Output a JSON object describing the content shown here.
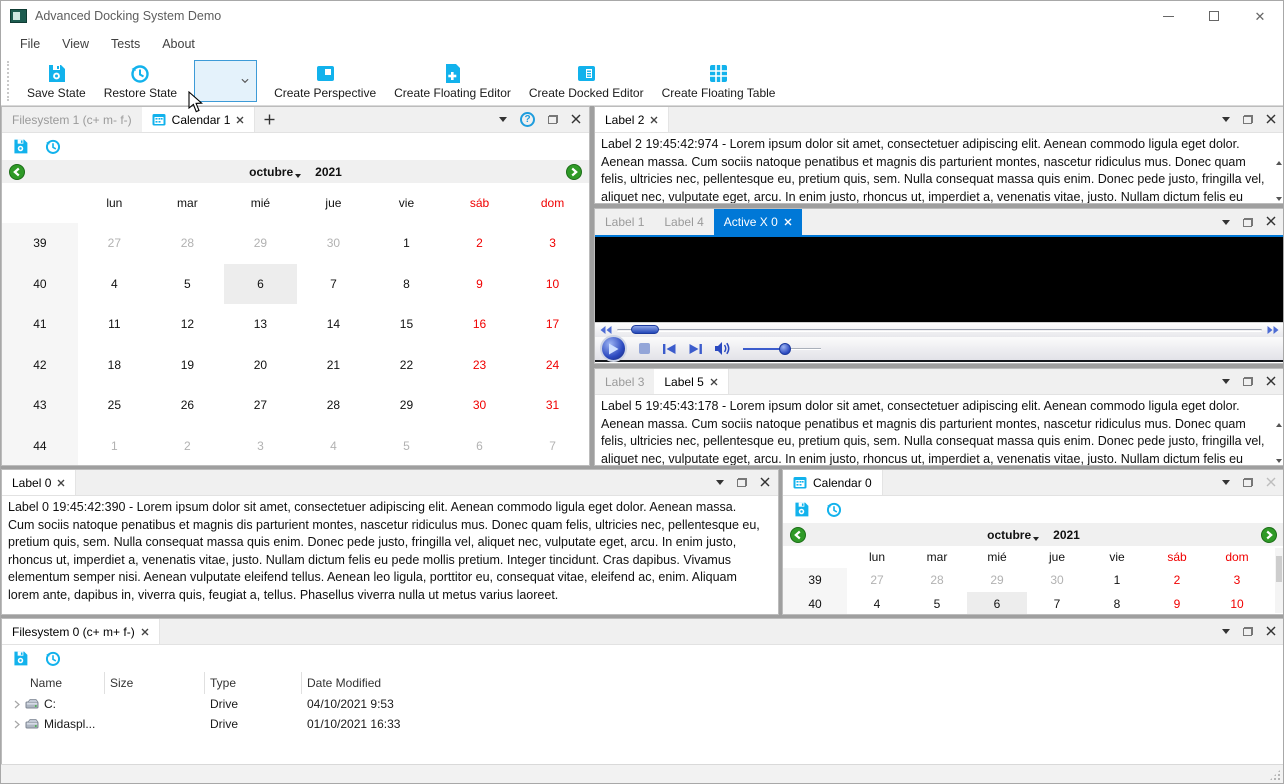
{
  "window": {
    "title": "Advanced Docking System Demo"
  },
  "menu": {
    "items": [
      "File",
      "View",
      "Tests",
      "About"
    ]
  },
  "toolbar": {
    "save_state": "Save State",
    "restore_state": "Restore State",
    "create_perspective": "Create Perspective",
    "create_floating_editor": "Create Floating Editor",
    "create_docked_editor": "Create Docked Editor",
    "create_floating_table": "Create Floating Table",
    "perspective_combo_value": ""
  },
  "icons": {
    "help_glyph": "?"
  },
  "colors": {
    "accent_cyan": "#12b2ec",
    "active_tab_blue": "#0078d7",
    "weekend_red": "#f00000",
    "nav_green": "#2f9a27",
    "media_blue": "#2b49c0"
  },
  "texts": {
    "lorem_short": "Lorem ipsum dolor sit amet, consectetuer adipiscing elit. Aenean commodo ligula eget dolor. Aenean massa. Cum sociis natoque penatibus et magnis dis parturient montes, nascetur ridiculus mus. Donec quam felis, ultricies nec, pellentesque eu, pretium quis, sem. Nulla consequat massa quis enim. Donec pede justo, fringilla vel, aliquet nec, vulputate eget, arcu. In enim justo, rhoncus ut, imperdiet a, venenatis vitae, justo. Nullam dictum felis eu pede mollis pretium. Integer tincidunt. Cras dapibus. Vivamus elementum semper nisi. Aenean vulputate eleifend tellus. Aenean leo ligula, porttitor eu, consequat vitae, eleifend ac, enim. Aliquam",
    "lorem_long": "Lorem ipsum dolor sit amet, consectetuer adipiscing elit. Aenean commodo ligula eget dolor. Aenean massa. Cum sociis natoque penatibus et magnis dis parturient montes, nascetur ridiculus mus. Donec quam felis, ultricies nec, pellentesque eu, pretium quis, sem. Nulla consequat massa quis enim. Donec pede justo, fringilla vel, aliquet nec, vulputate eget, arcu. In enim justo, rhoncus ut, imperdiet a, venenatis vitae, justo. Nullam dictum felis eu pede mollis pretium. Integer tincidunt. Cras dapibus. Vivamus elementum semper nisi. Aenean vulputate eleifend tellus. Aenean leo ligula, porttitor eu, consequat vitae, eleifend ac, enim. Aliquam lorem ante, dapibus in, viverra quis, feugiat a, tellus. Phasellus viverra nulla ut metus varius laoreet."
  },
  "panel_calendar1": {
    "tabs": {
      "filesystem": "Filesystem 1 (c+ m- f-)",
      "calendar": "Calendar 1"
    },
    "calendar": {
      "month": "octubre",
      "year": "2021",
      "weekdays": [
        "lun",
        "mar",
        "mié",
        "jue",
        "vie",
        "sáb",
        "dom"
      ],
      "weeks": [
        {
          "num": "39",
          "days": [
            {
              "v": "27",
              "s": "m"
            },
            {
              "v": "28",
              "s": "m"
            },
            {
              "v": "29",
              "s": "m"
            },
            {
              "v": "30",
              "s": "m"
            },
            {
              "v": "1",
              "s": "n"
            },
            {
              "v": "2",
              "s": "w"
            },
            {
              "v": "3",
              "s": "w"
            }
          ]
        },
        {
          "num": "40",
          "days": [
            {
              "v": "4",
              "s": "n"
            },
            {
              "v": "5",
              "s": "n"
            },
            {
              "v": "6",
              "s": "s"
            },
            {
              "v": "7",
              "s": "n"
            },
            {
              "v": "8",
              "s": "n"
            },
            {
              "v": "9",
              "s": "w"
            },
            {
              "v": "10",
              "s": "w"
            }
          ]
        },
        {
          "num": "41",
          "days": [
            {
              "v": "11",
              "s": "n"
            },
            {
              "v": "12",
              "s": "n"
            },
            {
              "v": "13",
              "s": "n"
            },
            {
              "v": "14",
              "s": "n"
            },
            {
              "v": "15",
              "s": "n"
            },
            {
              "v": "16",
              "s": "w"
            },
            {
              "v": "17",
              "s": "w"
            }
          ]
        },
        {
          "num": "42",
          "days": [
            {
              "v": "18",
              "s": "n"
            },
            {
              "v": "19",
              "s": "n"
            },
            {
              "v": "20",
              "s": "n"
            },
            {
              "v": "21",
              "s": "n"
            },
            {
              "v": "22",
              "s": "n"
            },
            {
              "v": "23",
              "s": "w"
            },
            {
              "v": "24",
              "s": "w"
            }
          ]
        },
        {
          "num": "43",
          "days": [
            {
              "v": "25",
              "s": "n"
            },
            {
              "v": "26",
              "s": "n"
            },
            {
              "v": "27",
              "s": "n"
            },
            {
              "v": "28",
              "s": "n"
            },
            {
              "v": "29",
              "s": "n"
            },
            {
              "v": "30",
              "s": "w"
            },
            {
              "v": "31",
              "s": "w"
            }
          ]
        },
        {
          "num": "44",
          "days": [
            {
              "v": "1",
              "s": "m"
            },
            {
              "v": "2",
              "s": "m"
            },
            {
              "v": "3",
              "s": "m"
            },
            {
              "v": "4",
              "s": "m"
            },
            {
              "v": "5",
              "s": "m"
            },
            {
              "v": "6",
              "s": "m"
            },
            {
              "v": "7",
              "s": "m"
            }
          ]
        }
      ]
    }
  },
  "panel_label2": {
    "tab": "Label 2",
    "prefix": "Label 2 19:45:42:974 - "
  },
  "panel_activex": {
    "tabs": [
      "Label 1",
      "Label 4",
      "Active X 0"
    ]
  },
  "panel_label5": {
    "tabs": [
      "Label 3",
      "Label 5"
    ],
    "prefix": "Label 5 19:45:43:178 - "
  },
  "panel_label0": {
    "tab": "Label 0",
    "prefix": "Label 0 19:45:42:390 - "
  },
  "panel_calendar0": {
    "tab": "Calendar 0",
    "calendar": {
      "month": "octubre",
      "year": "2021",
      "weekdays": [
        "lun",
        "mar",
        "mié",
        "jue",
        "vie",
        "sáb",
        "dom"
      ],
      "weeks": [
        {
          "num": "39",
          "days": [
            {
              "v": "27",
              "s": "m"
            },
            {
              "v": "28",
              "s": "m"
            },
            {
              "v": "29",
              "s": "m"
            },
            {
              "v": "30",
              "s": "m"
            },
            {
              "v": "1",
              "s": "n"
            },
            {
              "v": "2",
              "s": "w"
            },
            {
              "v": "3",
              "s": "w"
            }
          ]
        },
        {
          "num": "40",
          "days": [
            {
              "v": "4",
              "s": "n"
            },
            {
              "v": "5",
              "s": "n"
            },
            {
              "v": "6",
              "s": "s"
            },
            {
              "v": "7",
              "s": "n"
            },
            {
              "v": "8",
              "s": "n"
            },
            {
              "v": "9",
              "s": "w"
            },
            {
              "v": "10",
              "s": "w"
            }
          ]
        }
      ]
    }
  },
  "panel_filesystem0": {
    "tab": "Filesystem 0 (c+ m+ f-)",
    "table": {
      "headers": [
        "Name",
        "Size",
        "Type",
        "Date Modified"
      ],
      "rows": [
        {
          "name": "C:",
          "size": "",
          "type": "Drive",
          "date": "04/10/2021 9:53"
        },
        {
          "name": "Midaspl...",
          "size": "",
          "type": "Drive",
          "date": "01/10/2021 16:33"
        }
      ]
    }
  }
}
